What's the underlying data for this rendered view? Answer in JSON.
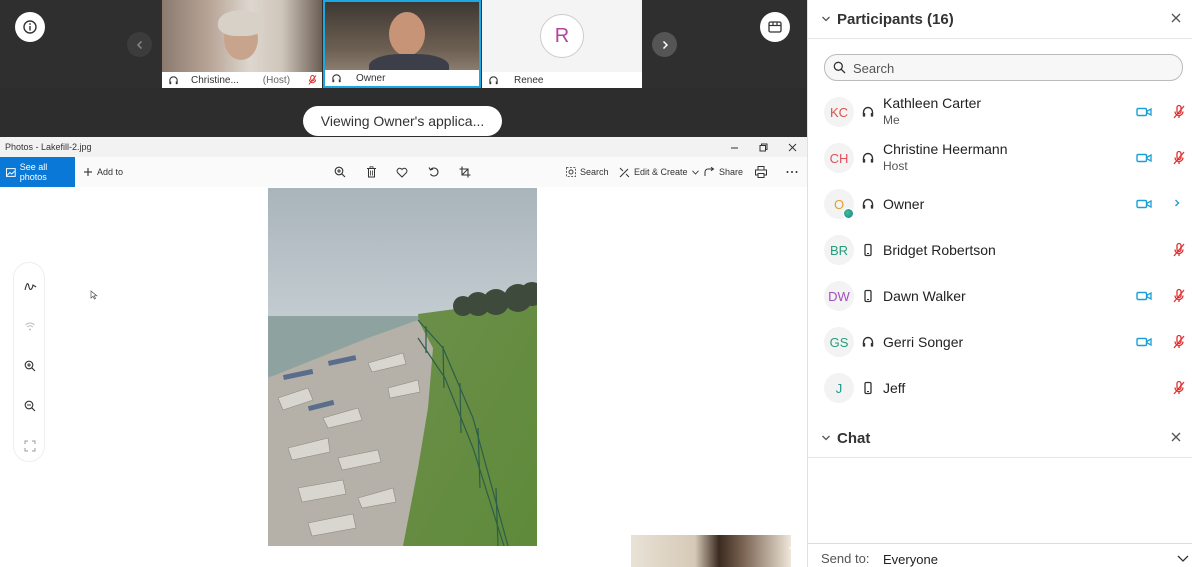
{
  "meeting": {
    "tiles": [
      {
        "name": "Christine...",
        "tag": "(Host)"
      },
      {
        "name": "Owner"
      },
      {
        "name": "Renee",
        "initial": "R"
      }
    ],
    "viewing_label": "Viewing Owner's applica..."
  },
  "photos": {
    "window_title": "Photos - Lakefill-2.jpg",
    "toolbar": {
      "see_all": "See all photos",
      "add_to": "Add to",
      "search": "Search",
      "edit_create": "Edit & Create",
      "share": "Share"
    }
  },
  "participants": {
    "title": "Participants (16)",
    "search_placeholder": "Search",
    "list": [
      {
        "initials": "KC",
        "name": "Kathleen Carter",
        "sub": "Me",
        "color": "#d9534f",
        "audio": "headset",
        "video": true,
        "mic": "muted"
      },
      {
        "initials": "CH",
        "name": "Christine Heermann",
        "sub": "Host",
        "color": "#e0505a",
        "audio": "headset",
        "video": true,
        "mic": "muted"
      },
      {
        "initials": "O",
        "name": "Owner",
        "sub": "",
        "color": "#e0a030",
        "audio": "headset",
        "video": true,
        "mic": "more"
      },
      {
        "initials": "BR",
        "name": "Bridget Robertson",
        "sub": "",
        "color": "#21a07a",
        "audio": "phone",
        "video": false,
        "mic": "muted"
      },
      {
        "initials": "DW",
        "name": "Dawn Walker",
        "sub": "",
        "color": "#a04fc0",
        "audio": "phone",
        "video": true,
        "mic": "muted"
      },
      {
        "initials": "GS",
        "name": "Gerri Songer",
        "sub": "",
        "color": "#21a07a",
        "audio": "headset",
        "video": true,
        "mic": "muted"
      },
      {
        "initials": "J",
        "name": "Jeff",
        "sub": "",
        "color": "#1f9a8a",
        "audio": "phone",
        "video": false,
        "mic": "muted"
      }
    ]
  },
  "chat": {
    "title": "Chat",
    "send_to_label": "Send to:",
    "send_to_value": "Everyone"
  }
}
